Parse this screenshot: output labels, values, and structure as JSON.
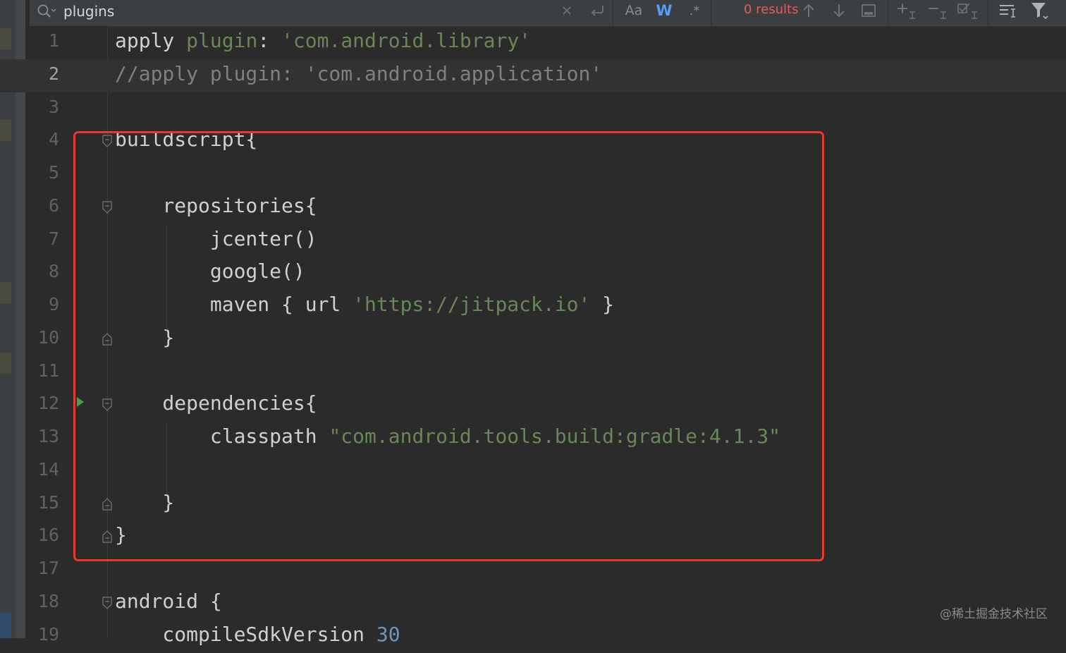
{
  "search": {
    "query": "plugins",
    "match_case_label": "Aa",
    "whole_words_label": "W",
    "regex_label": ".*",
    "results": "0 results"
  },
  "editor": {
    "current_line": 2,
    "lines": [
      {
        "num": "1",
        "segments": [
          {
            "text": "apply ",
            "cls": ""
          },
          {
            "text": "plugin",
            "cls": "str"
          },
          {
            "text": ": ",
            "cls": ""
          },
          {
            "text": "'com.android.library'",
            "cls": "str"
          }
        ]
      },
      {
        "num": "2",
        "segments": [
          {
            "text": "//apply plugin: 'com.android.application'",
            "cls": "cmt"
          }
        ]
      },
      {
        "num": "3",
        "segments": []
      },
      {
        "num": "4",
        "segments": [
          {
            "text": "buildscript{",
            "cls": ""
          }
        ]
      },
      {
        "num": "5",
        "segments": []
      },
      {
        "num": "6",
        "segments": [
          {
            "text": "    repositories{",
            "cls": ""
          }
        ]
      },
      {
        "num": "7",
        "segments": [
          {
            "text": "        jcenter()",
            "cls": ""
          }
        ]
      },
      {
        "num": "8",
        "segments": [
          {
            "text": "        google()",
            "cls": ""
          }
        ]
      },
      {
        "num": "9",
        "segments": [
          {
            "text": "        maven { url ",
            "cls": ""
          },
          {
            "text": "'https://jitpack.io'",
            "cls": "str"
          },
          {
            "text": " }",
            "cls": ""
          }
        ]
      },
      {
        "num": "10",
        "segments": [
          {
            "text": "    }",
            "cls": ""
          }
        ]
      },
      {
        "num": "11",
        "segments": []
      },
      {
        "num": "12",
        "segments": [
          {
            "text": "    dependencies{",
            "cls": ""
          }
        ]
      },
      {
        "num": "13",
        "segments": [
          {
            "text": "        classpath ",
            "cls": ""
          },
          {
            "text": "\"com.android.tools.build:gradle:4.1.3\"",
            "cls": "str"
          }
        ]
      },
      {
        "num": "14",
        "segments": []
      },
      {
        "num": "15",
        "segments": [
          {
            "text": "    }",
            "cls": ""
          }
        ]
      },
      {
        "num": "16",
        "segments": [
          {
            "text": "}",
            "cls": ""
          }
        ]
      },
      {
        "num": "17",
        "segments": []
      },
      {
        "num": "18",
        "segments": [
          {
            "text": "android {",
            "cls": ""
          }
        ]
      },
      {
        "num": "19",
        "segments": [
          {
            "text": "    compileSdkVersion ",
            "cls": ""
          },
          {
            "text": "30",
            "cls": "num"
          }
        ]
      }
    ]
  },
  "watermark": "@稀土掘金技术社区",
  "colors": {
    "editor_bg": "#2b2b2b",
    "string": "#6a8759",
    "comment": "#808080",
    "number": "#6897bb",
    "highlight_box": "#e53a2c",
    "results_error": "#e75a5a",
    "active_toggle": "#589df6"
  },
  "icons": [
    "search-icon",
    "clear-icon",
    "newline-icon",
    "arrow-up-icon",
    "arrow-down-icon",
    "open-in-window-icon",
    "add-selection-icon",
    "remove-selection-icon",
    "select-all-icon",
    "multiline-icon",
    "filter-icon",
    "fold-icon",
    "run-icon"
  ]
}
